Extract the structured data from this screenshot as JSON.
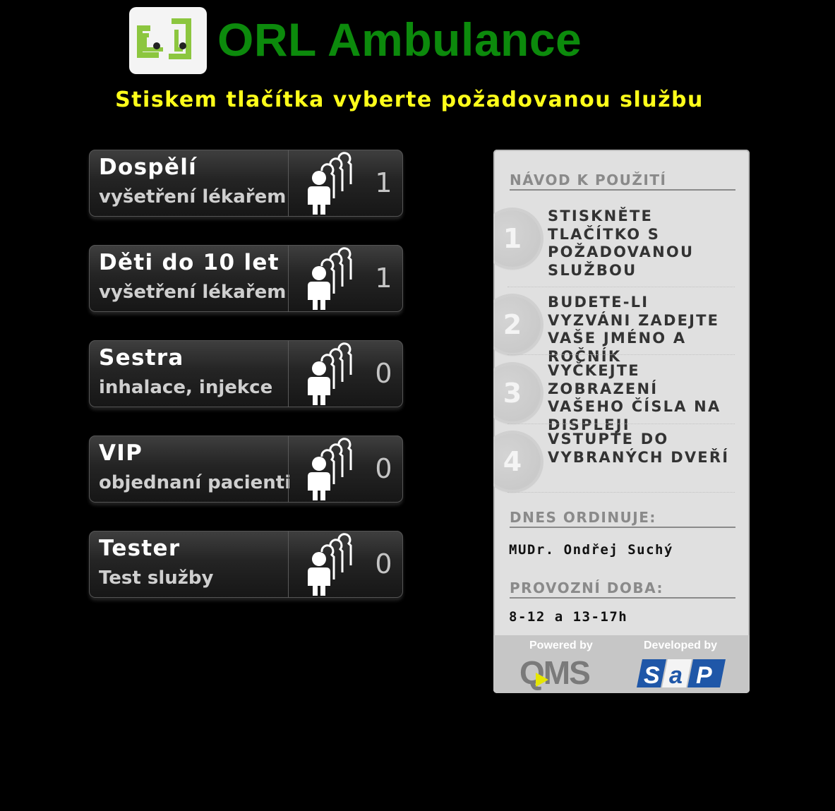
{
  "header": {
    "title": "ORL Ambulance",
    "subtitle": "Stiskem tlačítka vyberte požadovanou službu",
    "logo_text": "cL"
  },
  "services": [
    {
      "name": "Dospělí",
      "desc": "vyšetření lékařem",
      "count": "1"
    },
    {
      "name": "Děti do 10 let",
      "desc": "vyšetření lékařem",
      "count": "1"
    },
    {
      "name": "Sestra",
      "desc": "inhalace, injekce",
      "count": "0"
    },
    {
      "name": "VIP",
      "desc": "objednaní pacienti",
      "count": "0"
    },
    {
      "name": "Tester",
      "desc": "Test služby",
      "count": "0"
    }
  ],
  "icons": {
    "queue": "people-queue-icon"
  },
  "panel": {
    "instructions_title": "NÁVOD K POUŽITÍ",
    "steps": [
      {
        "num": "1",
        "text": "STISKNĚTE TLAČÍTKO S POŽADOVANOU SLUŽBOU"
      },
      {
        "num": "2",
        "text": "BUDETE-LI VYZVÁNI ZADEJTE VAŠE JMÉNO A ROČNÍK"
      },
      {
        "num": "3",
        "text": "VYČKEJTE ZOBRAZENÍ VAŠEHO ČÍSLA NA DISPLEJI"
      },
      {
        "num": "4",
        "text": "VSTUPTE DO VYBRANÝCH DVEŘÍ"
      }
    ],
    "doctor_title": "DNES ORDINUJE:",
    "doctor_name": "MUDr. Ondřej Suchý",
    "hours_title": "PROVOZNÍ DOBA:",
    "hours": "8-12 a 13-17h",
    "powered_by": "Powered by",
    "powered_logo": "QMS",
    "developed_by": "Developed by",
    "developed_logo": "SaP"
  },
  "colors": {
    "background": "#000000",
    "title": "#0c8a0c",
    "subtitle": "#ffff1a",
    "panel": "#e0e0e0"
  }
}
